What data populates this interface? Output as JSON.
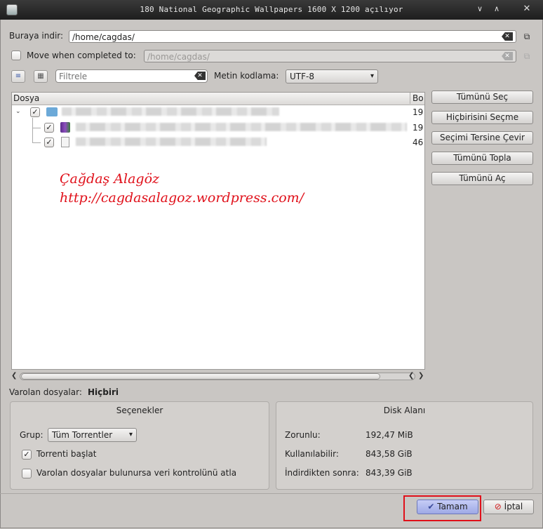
{
  "window": {
    "title": "180 National Geographic Wallpapers 1600 X 1200 açılıyor"
  },
  "download": {
    "label": "Buraya indir:",
    "path": "/home/cagdas/"
  },
  "move": {
    "label": "Move when completed to:",
    "path": "/home/cagdas/",
    "checked": false
  },
  "filter": {
    "placeholder": "Filtrele"
  },
  "encoding": {
    "label": "Metin kodlama:",
    "value": "UTF-8"
  },
  "file_tree": {
    "columns": [
      "Dosya",
      "Bo"
    ],
    "rows": [
      {
        "size": "19"
      },
      {
        "size": "19"
      },
      {
        "size": "46"
      }
    ]
  },
  "side_buttons": {
    "select_all": "Tümünü Seç",
    "select_none": "Hiçbirisini Seçme",
    "invert": "Seçimi Tersine Çevir",
    "collapse_all": "Tümünü Topla",
    "expand_all": "Tümünü Aç"
  },
  "watermark": {
    "name": "Çağdaş Alagöz",
    "url": "http://cagdasalagoz.wordpress.com/"
  },
  "existing_files": {
    "label": "Varolan dosyalar:",
    "value": "Hiçbiri"
  },
  "options": {
    "title": "Seçenekler",
    "group_label": "Grup:",
    "group_value": "Tüm Torrentler",
    "start_torrent": "Torrenti başlat",
    "start_torrent_checked": true,
    "skip_check": "Varolan dosyalar bulunursa veri kontrolünü atla",
    "skip_check_checked": false
  },
  "disk": {
    "title": "Disk Alanı",
    "required_label": "Zorunlu:",
    "required_value": "192,47 MiB",
    "available_label": "Kullanılabilir:",
    "available_value": "843,58 GiB",
    "after_label": "İndirdikten sonra:",
    "after_value": "843,39 GiB"
  },
  "footer": {
    "ok": "Tamam",
    "cancel": "İptal"
  },
  "colors": {
    "highlight": "#e0101a",
    "ok_button": "#a9b3ec"
  },
  "icons": [
    "window-icon",
    "minimize-icon",
    "maximize-icon",
    "close-icon",
    "clear-icon",
    "copy-icon",
    "list-view-icon",
    "details-view-icon",
    "folder-icon",
    "archive-icon",
    "text-file-icon",
    "check-icon",
    "cancel-icon"
  ]
}
